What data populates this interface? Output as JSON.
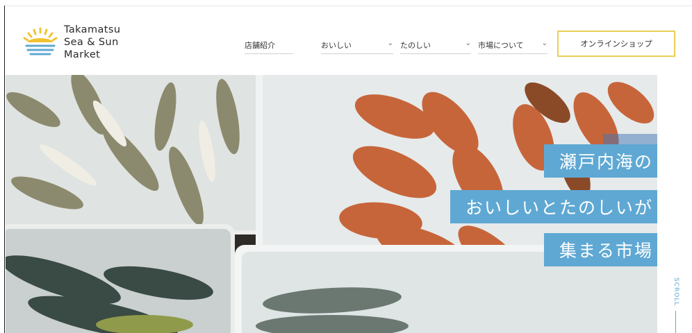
{
  "brand": {
    "name_lines": [
      "Takamatsu",
      "Sea & Sun",
      "Market"
    ],
    "sun_color": "#f2c233",
    "wave_color": "#5fa8d3"
  },
  "nav": {
    "items": [
      {
        "label": "店舗紹介",
        "has_dropdown": false
      },
      {
        "label": "おいしい",
        "has_dropdown": true
      },
      {
        "label": "たのしい",
        "has_dropdown": true
      },
      {
        "label": "市場について",
        "has_dropdown": true
      }
    ],
    "dropdown_icon": "chevron-down-icon",
    "chevron_glyph": "⌄"
  },
  "shop_button": {
    "label": "オンラインショップ",
    "border_color": "#e9cf55"
  },
  "hero": {
    "headline": [
      "瀬戸内海の",
      "おいしいとたのしいが",
      "集まる市場"
    ],
    "accent_color": "#5fa8d3"
  },
  "scroll": {
    "label": "SCROLL"
  }
}
